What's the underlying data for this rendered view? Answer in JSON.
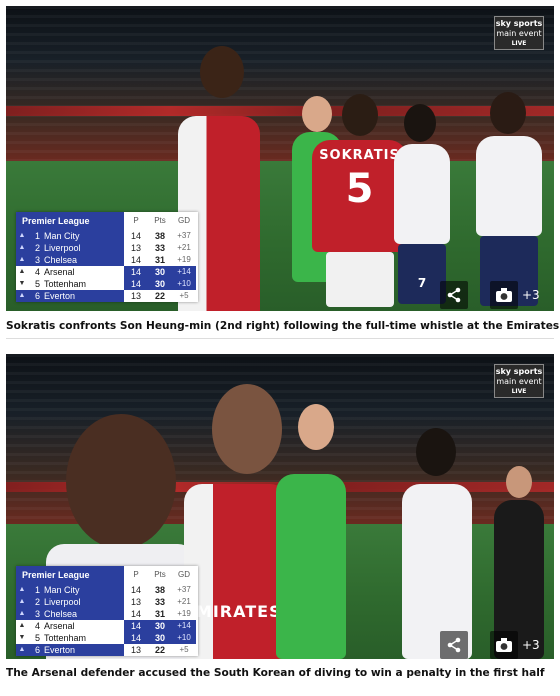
{
  "cards": [
    {
      "broadcaster": {
        "line1": "sky sports",
        "line2": "main event",
        "line3": "LIVE"
      },
      "players": {
        "p1_name": "SOKRATIS",
        "p1_number": "5",
        "p2_number": "7"
      },
      "caption": "Sokratis confronts Son Heung-min (2nd right) following the full-time whistle at the Emirates",
      "gallery_count": "+3"
    },
    {
      "broadcaster": {
        "line1": "sky sports",
        "line2": "main event",
        "line3": "LIVE"
      },
      "players": {
        "p1_name": "EMIRATES",
        "p1_number": "",
        "p2_number": ""
      },
      "caption": "The Arsenal defender accused the South Korean of diving to win a penalty in the first half",
      "gallery_count": "+3"
    }
  ],
  "table": {
    "league": "Premier League",
    "headers": [
      "P",
      "Pts",
      "GD"
    ],
    "rows": [
      {
        "arrow": "▲",
        "pos": "1",
        "team": "Man City",
        "p": "14",
        "pts": "38",
        "gd": "+37",
        "highlight": false
      },
      {
        "arrow": "▲",
        "pos": "2",
        "team": "Liverpool",
        "p": "13",
        "pts": "33",
        "gd": "+21",
        "highlight": false
      },
      {
        "arrow": "▲",
        "pos": "3",
        "team": "Chelsea",
        "p": "14",
        "pts": "31",
        "gd": "+19",
        "highlight": false
      },
      {
        "arrow": "▲",
        "pos": "4",
        "team": "Arsenal",
        "p": "14",
        "pts": "30",
        "gd": "+14",
        "highlight": true
      },
      {
        "arrow": "▼",
        "pos": "5",
        "team": "Tottenham",
        "p": "14",
        "pts": "30",
        "gd": "+10",
        "highlight": true
      },
      {
        "arrow": "▲",
        "pos": "6",
        "team": "Everton",
        "p": "13",
        "pts": "22",
        "gd": "+5",
        "highlight": false
      }
    ]
  },
  "icons": {
    "share": "share-icon",
    "gallery": "camera-icon"
  },
  "colors": {
    "table_blue": "#2b3f9e",
    "arsenal_red": "#c0202a",
    "keeper_green": "#3bb54a"
  }
}
